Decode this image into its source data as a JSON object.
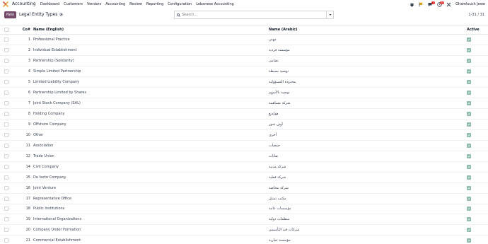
{
  "navbar": {
    "brand": "Accounting",
    "menu": [
      "Dashboard",
      "Customers",
      "Vendors",
      "Accounting",
      "Review",
      "Reporting",
      "Configuration",
      "Lebanese Accounting"
    ],
    "messages_badge": "1",
    "activity_badge": "25",
    "user": "Ghamlouch Jewe"
  },
  "control_panel": {
    "new_label": "New",
    "title": "Legal Entity Types",
    "search_placeholder": "Search...",
    "pager": "1-31 / 31"
  },
  "table": {
    "headers": {
      "seq": "Co#",
      "name": "Name (English)",
      "arabic": "Name (Arabic)",
      "active": "Active"
    },
    "rows": [
      {
        "seq": "1",
        "name": "Professional Practice",
        "arabic": "مهني"
      },
      {
        "seq": "2",
        "name": "Individual Establishment",
        "arabic": "مؤسسة فردية"
      },
      {
        "seq": "3",
        "name": "Partnership (Solidarity)",
        "arabic": "تضامن"
      },
      {
        "seq": "4",
        "name": "Simple Limited Partnership",
        "arabic": "توصية بسيطة"
      },
      {
        "seq": "5",
        "name": "Limited Liability Company",
        "arabic": "محدودة المسؤولية"
      },
      {
        "seq": "6",
        "name": "Partnership Limited by Shares",
        "arabic": "توصية بالأسهم"
      },
      {
        "seq": "7",
        "name": "Joint Stock Company (SAL)",
        "arabic": "شركة مساهمة"
      },
      {
        "seq": "8",
        "name": "Holding Company",
        "arabic": "هولدنغ"
      },
      {
        "seq": "9",
        "name": "Offshore Company",
        "arabic": "أوف شور"
      },
      {
        "seq": "10",
        "name": "Other",
        "arabic": "أخرى"
      },
      {
        "seq": "11",
        "name": "Association",
        "arabic": "جمعيات"
      },
      {
        "seq": "12",
        "name": "Trade Union",
        "arabic": "نقابات"
      },
      {
        "seq": "14",
        "name": "Civil Company",
        "arabic": "شركة مدنية"
      },
      {
        "seq": "15",
        "name": "De facto Company",
        "arabic": "شركة فعلية"
      },
      {
        "seq": "16",
        "name": "Joint Venture",
        "arabic": "شركة محاصة"
      },
      {
        "seq": "17",
        "name": "Representative Office",
        "arabic": "مكتب تمثيل"
      },
      {
        "seq": "18",
        "name": "Public Institutions",
        "arabic": "مؤسسات عامة"
      },
      {
        "seq": "19",
        "name": "International Organizations",
        "arabic": "منظمات دولية"
      },
      {
        "seq": "20",
        "name": "Company Under Formation",
        "arabic": "شركات قيد التأسيس"
      },
      {
        "seq": "21",
        "name": "Commercial Establishment",
        "arabic": "مؤسسة تجارية"
      }
    ]
  },
  "colors": {
    "brand": "#714B67",
    "active_check": "#8fbcaa"
  }
}
